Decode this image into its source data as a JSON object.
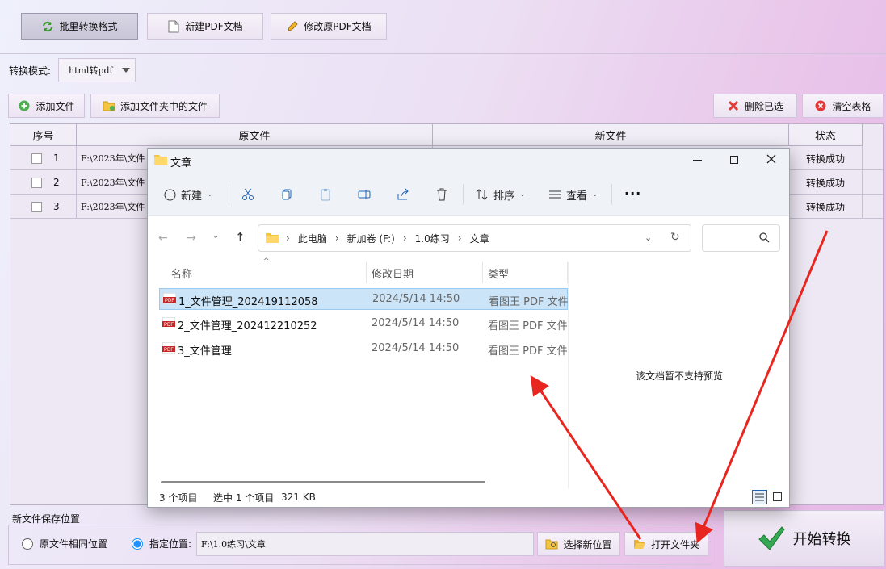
{
  "toolbar": {
    "batch_label": "批里转换格式",
    "new_pdf_label": "新建PDF文档",
    "modify_pdf_label": "修改原PDF文档"
  },
  "mode": {
    "label": "转换模式:",
    "value": "html转pdf"
  },
  "actions": {
    "add_file": "添加文件",
    "add_folder": "添加文件夹中的文件",
    "delete_selected": "删除已选",
    "clear_table": "清空表格"
  },
  "table": {
    "columns": [
      "序号",
      "原文件",
      "新文件",
      "状态"
    ],
    "rows": [
      {
        "index": "1",
        "source": "F:\\2023年\\文件",
        "status": "转换成功"
      },
      {
        "index": "2",
        "source": "F:\\2023年\\文件",
        "status": "转换成功"
      },
      {
        "index": "3",
        "source": "F:\\2023年\\文件",
        "status": "转换成功"
      }
    ]
  },
  "explorer": {
    "title": "文章",
    "commands": {
      "new": "新建",
      "sort": "排序",
      "view": "查看"
    },
    "breadcrumb": [
      "此电脑",
      "新加卷 (F:)",
      "1.0练习",
      "文章"
    ],
    "columns": {
      "name": "名称",
      "date": "修改日期",
      "type": "类型"
    },
    "files": [
      {
        "name": "1_文件管理_202419112058",
        "date": "2024/5/14 14:50",
        "type": "看图王 PDF 文件"
      },
      {
        "name": "2_文件管理_202412210252",
        "date": "2024/5/14 14:50",
        "type": "看图王 PDF 文件"
      },
      {
        "name": "3_文件管理",
        "date": "2024/5/14 14:50",
        "type": "看图王 PDF 文件"
      }
    ],
    "preview_text": "该文档暂不支持预览",
    "status": {
      "count": "3 个项目",
      "selected": "选中 1 个项目",
      "size": "321 KB"
    }
  },
  "save": {
    "group_label": "新文件保存位置",
    "same_location": "原文件相同位置",
    "specified": "指定位置:",
    "path": "F:\\1.0练习\\文章",
    "choose_location": "选择新位置",
    "open_folder": "打开文件夹",
    "start": "开始转换"
  },
  "colors": {
    "accent": "#1e90ff",
    "arrow": "#e8261f",
    "selected_row": "#cce4f7"
  }
}
